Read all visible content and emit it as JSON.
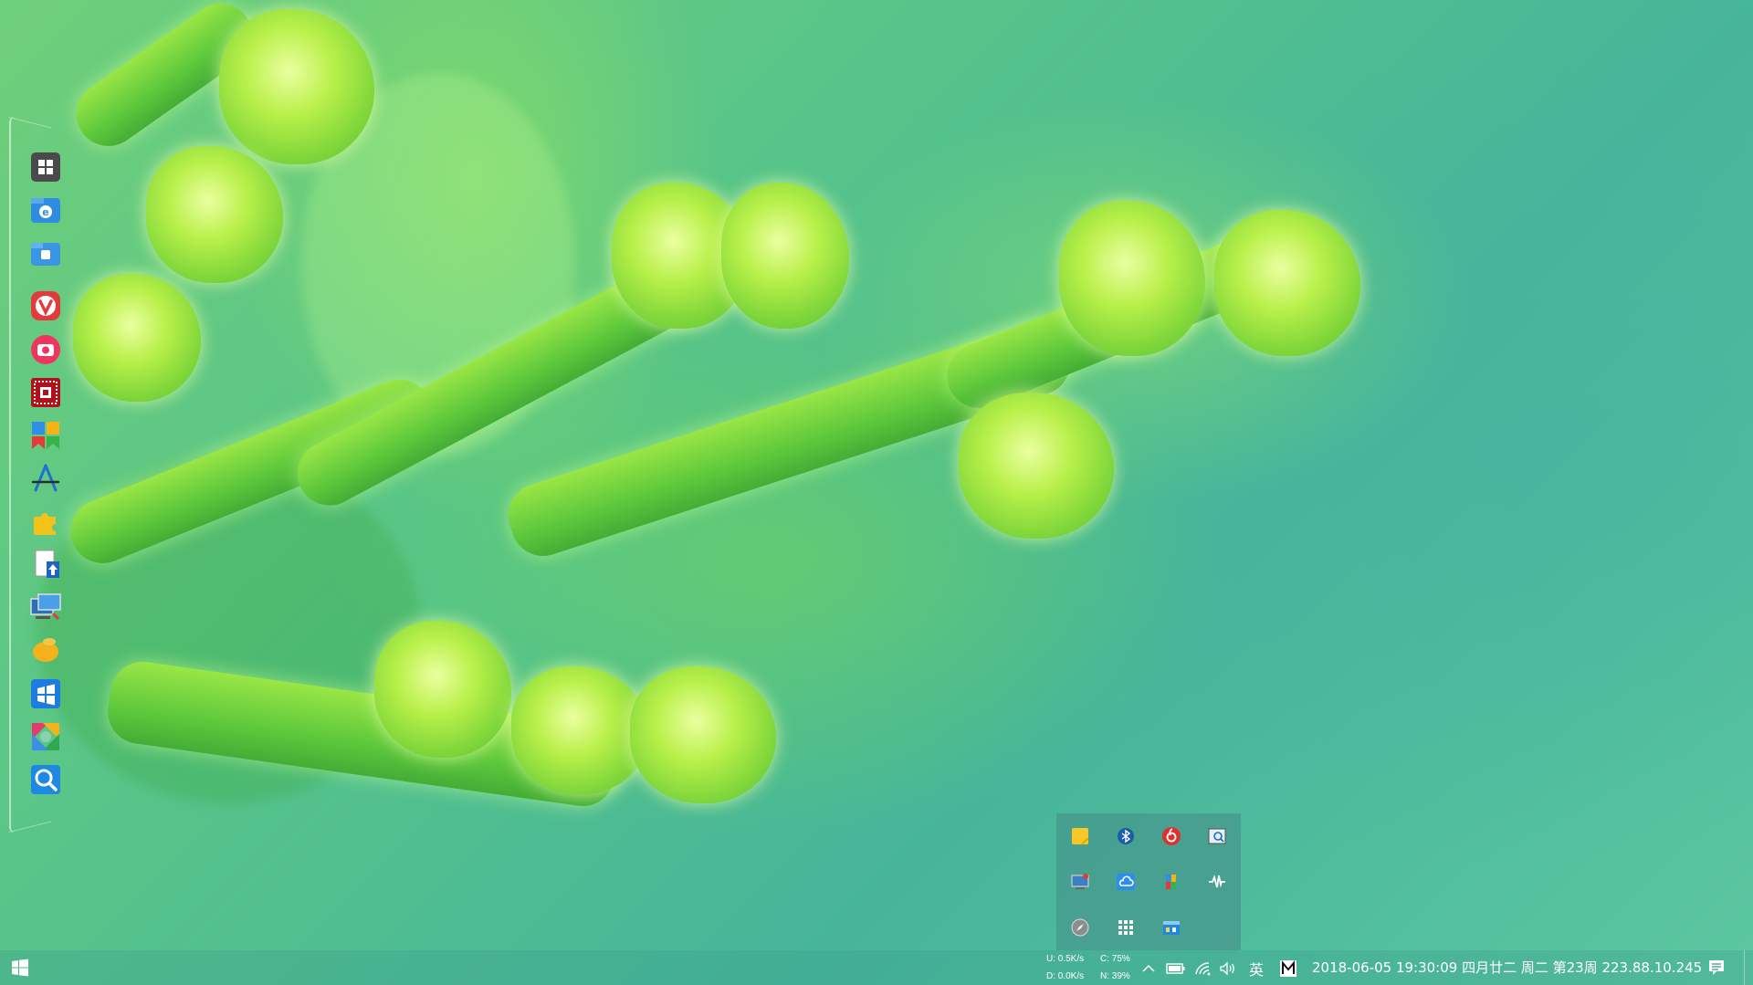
{
  "wallpaper": {
    "name": "green-plant-wallpaper"
  },
  "dock": {
    "items": [
      {
        "name": "start-menu-icon"
      },
      {
        "name": "internet-explorer-icon"
      },
      {
        "name": "file-explorer-icon"
      },
      {
        "name": "vivaldi-icon"
      },
      {
        "name": "camera-icon"
      },
      {
        "name": "screen-capture-icon"
      },
      {
        "name": "color-blocks-app-icon"
      },
      {
        "name": "app-store-icon"
      },
      {
        "name": "puzzle-plugin-icon"
      },
      {
        "name": "file-upload-icon"
      },
      {
        "name": "remote-desktop-icon"
      },
      {
        "name": "fruit-app-icon"
      },
      {
        "name": "windows-store-icon"
      },
      {
        "name": "photos-app-icon"
      },
      {
        "name": "search-icon"
      }
    ]
  },
  "tray_flyout": {
    "items": [
      {
        "name": "sticky-notes-icon"
      },
      {
        "name": "bluetooth-icon"
      },
      {
        "name": "netease-music-icon"
      },
      {
        "name": "screen-reader-icon"
      },
      {
        "name": "monitor-tool-icon"
      },
      {
        "name": "cloud-drive-icon"
      },
      {
        "name": "color-picker-icon"
      },
      {
        "name": "audio-wave-icon"
      },
      {
        "name": "compass-icon"
      },
      {
        "name": "grid-app-icon"
      },
      {
        "name": "control-panel-icon"
      }
    ]
  },
  "taskbar": {
    "net_upload": "U: 0.5K/s",
    "net_download": "D: 0.0K/s",
    "cpu": "C: 75%",
    "mem": "N: 39%",
    "ime_label": "英",
    "clock_text": "2018-06-05  19:30:09  四月廿二  周二  第23周  223.88.10.245"
  },
  "colors": {
    "accent": "#3fb3a0",
    "taskbar_text": "#ffffff"
  }
}
